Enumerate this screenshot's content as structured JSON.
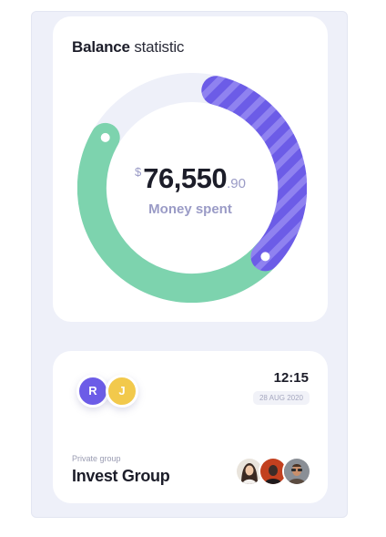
{
  "balance": {
    "title_bold": "Balance",
    "title_light": "statistic",
    "currency": "$",
    "amount_integer": "76,550",
    "amount_decimal": ".90",
    "amount_label": "Money spent",
    "ring_fraction_purple": 0.3,
    "colors": {
      "green": "#7dd3ae",
      "purple": "#6c5ce7",
      "track": "#eef0f9"
    }
  },
  "group": {
    "avatars": [
      {
        "initial": "R",
        "color": "#6c5ce7"
      },
      {
        "initial": "J",
        "color": "#f2c94c"
      }
    ],
    "time": "12:15",
    "date": "28 AUG 2020",
    "subtitle": "Private group",
    "name": "Invest Group",
    "members": [
      {
        "icon": "member-photo-woman"
      },
      {
        "icon": "member-photo-man"
      },
      {
        "icon": "member-photo-man-glasses"
      }
    ]
  }
}
